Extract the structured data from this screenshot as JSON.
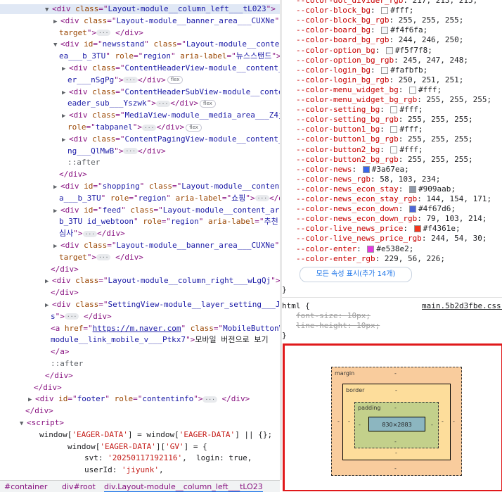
{
  "elements_tree": {
    "lines": [
      {
        "indent": 64,
        "arrow": "▼",
        "parts": [
          [
            "tag",
            "<div "
          ],
          [
            "an",
            "class"
          ],
          [
            "tag",
            "=\""
          ],
          [
            "av",
            "Layout-module__column_left___tL023"
          ],
          [
            "tag",
            "\">"
          ]
        ],
        "suffix": "== $0",
        "selected": true
      },
      {
        "indent": 76,
        "arrow": "▶",
        "parts": [
          [
            "tag",
            "<div "
          ],
          [
            "an",
            "class"
          ],
          [
            "tag",
            "=\""
          ],
          [
            "av",
            "Layout-module__banner_area___CUXNe"
          ],
          [
            "tag",
            "\""
          ]
        ]
      },
      {
        "indent": 84,
        "arrow": "",
        "parts": [
          [
            "an",
            "target"
          ],
          [
            "tag",
            "\">"
          ]
        ],
        "ell": true,
        "after": [
          [
            "tag",
            " </div>"
          ]
        ]
      },
      {
        "indent": 76,
        "arrow": "▼",
        "parts": [
          [
            "tag",
            "<div "
          ],
          [
            "an",
            "id"
          ],
          [
            "tag",
            "=\""
          ],
          [
            "av",
            "newsstand"
          ],
          [
            "tag",
            "\" "
          ],
          [
            "an",
            "class"
          ],
          [
            "tag",
            "=\""
          ],
          [
            "av",
            "Layout-module__content_ar"
          ]
        ]
      },
      {
        "indent": 84,
        "arrow": "",
        "parts": [
          [
            "av",
            "ea___b_3TU"
          ],
          [
            "tag",
            "\" "
          ],
          [
            "an",
            "role"
          ],
          [
            "tag",
            "=\""
          ],
          [
            "av",
            "region"
          ],
          [
            "tag",
            "\" "
          ],
          [
            "an",
            "aria-label"
          ],
          [
            "tag",
            "=\""
          ],
          [
            "av",
            "뉴스스탠드"
          ],
          [
            "tag",
            "\">"
          ]
        ]
      },
      {
        "indent": 88,
        "arrow": "▶",
        "parts": [
          [
            "tag",
            "<div "
          ],
          [
            "an",
            "class"
          ],
          [
            "tag",
            "=\""
          ],
          [
            "av",
            "ContentHeaderView-module__content_head"
          ]
        ]
      },
      {
        "indent": 96,
        "arrow": "",
        "parts": [
          [
            "av",
            "er___nSgPg"
          ],
          [
            "tag",
            "\">"
          ]
        ],
        "ell": true,
        "after": [
          [
            "tag",
            "</div>"
          ]
        ],
        "flex": true
      },
      {
        "indent": 88,
        "arrow": "▶",
        "parts": [
          [
            "tag",
            "<div "
          ],
          [
            "an",
            "class"
          ],
          [
            "tag",
            "=\""
          ],
          [
            "av",
            "ContentHeaderSubView-module__content_h"
          ]
        ]
      },
      {
        "indent": 96,
        "arrow": "",
        "parts": [
          [
            "av",
            "eader_sub___Yszwk"
          ],
          [
            "tag",
            "\">"
          ]
        ],
        "ell": true,
        "after": [
          [
            "tag",
            "</div>"
          ]
        ],
        "flex": true
      },
      {
        "indent": 88,
        "arrow": "▶",
        "parts": [
          [
            "tag",
            "<div "
          ],
          [
            "an",
            "class"
          ],
          [
            "tag",
            "=\""
          ],
          [
            "av",
            "MediaView-module__media_area___Z4js3"
          ],
          [
            "tag",
            "\""
          ]
        ]
      },
      {
        "indent": 96,
        "arrow": "",
        "parts": [
          [
            "an",
            "role"
          ],
          [
            "tag",
            "=\""
          ],
          [
            "av",
            "tabpanel"
          ],
          [
            "tag",
            "\">"
          ]
        ],
        "ell": true,
        "after": [
          [
            "tag",
            "</div>"
          ]
        ],
        "flex": true
      },
      {
        "indent": 88,
        "arrow": "▶",
        "parts": [
          [
            "tag",
            "<div "
          ],
          [
            "an",
            "class"
          ],
          [
            "tag",
            "=\""
          ],
          [
            "av",
            "ContentPagingView-module__content_pagi"
          ]
        ]
      },
      {
        "indent": 96,
        "arrow": "",
        "parts": [
          [
            "av",
            "ng___QlMwB"
          ],
          [
            "tag",
            "\">"
          ]
        ],
        "ell": true,
        "after": [
          [
            "tag",
            "</div>"
          ]
        ]
      },
      {
        "indent": 96,
        "arrow": "",
        "parts": [
          [
            "pseudo",
            "::after"
          ]
        ]
      },
      {
        "indent": 84,
        "arrow": "",
        "parts": [
          [
            "tag",
            "</div>"
          ]
        ]
      },
      {
        "indent": 76,
        "arrow": "▶",
        "parts": [
          [
            "tag",
            "<div "
          ],
          [
            "an",
            "id"
          ],
          [
            "tag",
            "=\""
          ],
          [
            "av",
            "shopping"
          ],
          [
            "tag",
            "\" "
          ],
          [
            "an",
            "class"
          ],
          [
            "tag",
            "=\""
          ],
          [
            "av",
            "Layout-module__content_are"
          ]
        ]
      },
      {
        "indent": 84,
        "arrow": "",
        "parts": [
          [
            "av",
            "a___b_3TU"
          ],
          [
            "tag",
            "\" "
          ],
          [
            "an",
            "role"
          ],
          [
            "tag",
            "=\""
          ],
          [
            "av",
            "region"
          ],
          [
            "tag",
            "\" "
          ],
          [
            "an",
            "aria-label"
          ],
          [
            "tag",
            "=\""
          ],
          [
            "av",
            "쇼핑"
          ],
          [
            "tag",
            "\">"
          ]
        ],
        "ell": true,
        "after": [
          [
            "tag",
            "</div>"
          ]
        ]
      },
      {
        "indent": 76,
        "arrow": "▶",
        "parts": [
          [
            "tag",
            "<div "
          ],
          [
            "an",
            "id"
          ],
          [
            "tag",
            "=\""
          ],
          [
            "av",
            "feed"
          ],
          [
            "tag",
            "\" "
          ],
          [
            "an",
            "class"
          ],
          [
            "tag",
            "=\""
          ],
          [
            "av",
            "Layout-module__content_area___"
          ]
        ]
      },
      {
        "indent": 84,
        "arrow": "",
        "parts": [
          [
            "av",
            "b_3TU id_webtoon"
          ],
          [
            "tag",
            "\" "
          ],
          [
            "an",
            "role"
          ],
          [
            "tag",
            "=\""
          ],
          [
            "av",
            "region"
          ],
          [
            "tag",
            "\" "
          ],
          [
            "an",
            "aria-label"
          ],
          [
            "tag",
            "=\""
          ],
          [
            "av",
            "추천 관"
          ]
        ]
      },
      {
        "indent": 84,
        "arrow": "",
        "parts": [
          [
            "av",
            "심사"
          ],
          [
            "tag",
            "\">"
          ]
        ],
        "ell": true,
        "after": [
          [
            "tag",
            "</div>"
          ]
        ]
      },
      {
        "indent": 76,
        "arrow": "▶",
        "parts": [
          [
            "tag",
            "<div "
          ],
          [
            "an",
            "class"
          ],
          [
            "tag",
            "=\""
          ],
          [
            "av",
            "Layout-module__banner_area___CUXNe"
          ],
          [
            "tag",
            "\""
          ]
        ]
      },
      {
        "indent": 84,
        "arrow": "",
        "parts": [
          [
            "an",
            "target"
          ],
          [
            "tag",
            "\">"
          ]
        ],
        "ell": true,
        "after": [
          [
            "tag",
            " </div>"
          ]
        ]
      },
      {
        "indent": 72,
        "arrow": "",
        "parts": [
          [
            "tag",
            "</div>"
          ]
        ]
      },
      {
        "indent": 64,
        "arrow": "▶",
        "parts": [
          [
            "tag",
            "<div "
          ],
          [
            "an",
            "class"
          ],
          [
            "tag",
            "=\""
          ],
          [
            "av",
            "Layout-module__column_right___wLgQj"
          ],
          [
            "tag",
            "\">"
          ]
        ],
        "ell": true
      },
      {
        "indent": 72,
        "arrow": "",
        "parts": [
          [
            "tag",
            "</div>"
          ]
        ]
      },
      {
        "indent": 64,
        "arrow": "▶",
        "parts": [
          [
            "tag",
            "<div "
          ],
          [
            "an",
            "class"
          ],
          [
            "tag",
            "=\""
          ],
          [
            "av",
            "SettingView-module__layer_setting___JwfQ"
          ]
        ]
      },
      {
        "indent": 72,
        "arrow": "",
        "parts": [
          [
            "av",
            "s"
          ],
          [
            "tag",
            "\">"
          ]
        ],
        "ell": true,
        "after": [
          [
            "tag",
            " </div>"
          ]
        ]
      },
      {
        "indent": 72,
        "arrow": "",
        "parts": [
          [
            "tag",
            "<a "
          ],
          [
            "an",
            "href"
          ],
          [
            "tag",
            "=\""
          ],
          [
            "lnk",
            "https://m.naver.com"
          ],
          [
            "tag",
            "\" "
          ],
          [
            "an",
            "class"
          ],
          [
            "tag",
            "=\""
          ],
          [
            "av",
            "MobileButtonView-"
          ]
        ]
      },
      {
        "indent": 72,
        "arrow": "",
        "parts": [
          [
            "av",
            "module__link_mobile_v___Ptkx7"
          ],
          [
            "tag",
            "\">"
          ],
          [
            "txt",
            "모바일 버전으로 보기"
          ]
        ]
      },
      {
        "indent": 72,
        "arrow": "",
        "parts": [
          [
            "tag",
            "</a>"
          ]
        ]
      },
      {
        "indent": 72,
        "arrow": "",
        "parts": [
          [
            "pseudo",
            "::after"
          ]
        ]
      },
      {
        "indent": 64,
        "arrow": "",
        "parts": [
          [
            "tag",
            "</div>"
          ]
        ]
      },
      {
        "indent": 48,
        "arrow": "",
        "parts": [
          [
            "tag",
            "</div>"
          ]
        ]
      },
      {
        "indent": 40,
        "arrow": "▶",
        "parts": [
          [
            "tag",
            "<div "
          ],
          [
            "an",
            "id"
          ],
          [
            "tag",
            "=\""
          ],
          [
            "av",
            "footer"
          ],
          [
            "tag",
            "\" "
          ],
          [
            "an",
            "role"
          ],
          [
            "tag",
            "=\""
          ],
          [
            "av",
            "contentinfo"
          ],
          [
            "tag",
            "\">"
          ]
        ],
        "ell": true,
        "after": [
          [
            "tag",
            " </div>"
          ]
        ]
      },
      {
        "indent": 36,
        "arrow": "",
        "parts": [
          [
            "tag",
            "</div>"
          ]
        ]
      },
      {
        "indent": 28,
        "arrow": "▼",
        "parts": [
          [
            "tag",
            "<script>"
          ]
        ]
      },
      {
        "indent": 56,
        "arrow": "",
        "parts": [
          [
            "txt",
            "window["
          ],
          [
            "str",
            "'EAGER-DATA'"
          ],
          [
            "txt",
            "] = window["
          ],
          [
            "str",
            "'EAGER-DATA'"
          ],
          [
            "txt",
            "] || {};"
          ]
        ]
      },
      {
        "indent": 96,
        "arrow": "",
        "parts": [
          [
            "txt",
            "window["
          ],
          [
            "str",
            "'EAGER-DATA'"
          ],
          [
            "txt",
            "]["
          ],
          [
            "str",
            "'GV'"
          ],
          [
            "txt",
            "] = {"
          ]
        ]
      },
      {
        "indent": 120,
        "arrow": "",
        "parts": [
          [
            "txt",
            "svt: "
          ],
          [
            "str",
            "'20250117192116'"
          ],
          [
            "txt",
            ",  login: true,"
          ]
        ]
      },
      {
        "indent": 120,
        "arrow": "",
        "parts": [
          [
            "txt",
            "userId: "
          ],
          [
            "str",
            "'jiyunk'"
          ],
          [
            "txt",
            ","
          ]
        ]
      }
    ]
  },
  "breadcrumbs": [
    "#container",
    "div#root",
    "div.Layout-module__column_left___tLO23"
  ],
  "styles": {
    "vars": [
      {
        "name": "--color-dot_divider_rgb",
        "value": "217, 213, 215",
        "swatch": null
      },
      {
        "name": "--color-block_bg",
        "value": "#fff",
        "swatch": "#ffffff"
      },
      {
        "name": "--color-block_bg_rgb",
        "value": "255, 255, 255",
        "swatch": null
      },
      {
        "name": "--color-board_bg",
        "value": "#f4f6fa",
        "swatch": "#f4f6fa"
      },
      {
        "name": "--color-board_bg_rgb",
        "value": "244, 246, 250",
        "swatch": null
      },
      {
        "name": "--color-option_bg",
        "value": "#f5f7f8",
        "swatch": "#f5f7f8"
      },
      {
        "name": "--color-option_bg_rgb",
        "value": "245, 247, 248",
        "swatch": null
      },
      {
        "name": "--color-login_bg",
        "value": "#fafbfb",
        "swatch": "#fafbfb"
      },
      {
        "name": "--color-login_bg_rgb",
        "value": "250, 251, 251",
        "swatch": null
      },
      {
        "name": "--color-menu_widget_bg",
        "value": "#fff",
        "swatch": "#ffffff"
      },
      {
        "name": "--color-menu_widget_bg_rgb",
        "value": "255, 255, 255",
        "swatch": null
      },
      {
        "name": "--color-setting_bg",
        "value": "#fff",
        "swatch": "#ffffff"
      },
      {
        "name": "--color-setting_bg_rgb",
        "value": "255, 255, 255",
        "swatch": null
      },
      {
        "name": "--color-button1_bg",
        "value": "#fff",
        "swatch": "#ffffff"
      },
      {
        "name": "--color-button1_bg_rgb",
        "value": "255, 255, 255",
        "swatch": null
      },
      {
        "name": "--color-button2_bg",
        "value": "#fff",
        "swatch": "#ffffff"
      },
      {
        "name": "--color-button2_bg_rgb",
        "value": "255, 255, 255",
        "swatch": null
      },
      {
        "name": "--color-news",
        "value": "#3a67ea",
        "swatch": "#3a67ea"
      },
      {
        "name": "--color-news_rgb",
        "value": "58, 103, 234",
        "swatch": null
      },
      {
        "name": "--color-news_econ_stay",
        "value": "#909aab",
        "swatch": "#909aab"
      },
      {
        "name": "--color-news_econ_stay_rgb",
        "value": "144, 154, 171",
        "swatch": null
      },
      {
        "name": "--color-news_econ_down",
        "value": "#4f67d6",
        "swatch": "#4f67d6"
      },
      {
        "name": "--color-news_econ_down_rgb",
        "value": "79, 103, 214",
        "swatch": null
      },
      {
        "name": "--color-live_news_price",
        "value": "#f4361e",
        "swatch": "#f4361e"
      },
      {
        "name": "--color-live_news_price_rgb",
        "value": "244, 54, 30",
        "swatch": null
      },
      {
        "name": "--color-enter",
        "value": "#e538e2",
        "swatch": "#e538e2"
      },
      {
        "name": "--color-enter_rgb",
        "value": "229, 56, 226",
        "swatch": null
      }
    ],
    "more_button_label": "모든 속성 표시(추가 14개)",
    "close_brace": "}",
    "html_rule": {
      "selector": "html {",
      "source": "main.5b2d3fbe.css:4",
      "props": [
        {
          "name": "font-size",
          "value": "10px;"
        },
        {
          "name": "line-height",
          "value": "10px;"
        }
      ],
      "close": "}"
    }
  },
  "box_model": {
    "margin_label": "margin",
    "border_label": "border",
    "padding_label": "padding",
    "dash": "-",
    "content_size": "830×2883"
  }
}
